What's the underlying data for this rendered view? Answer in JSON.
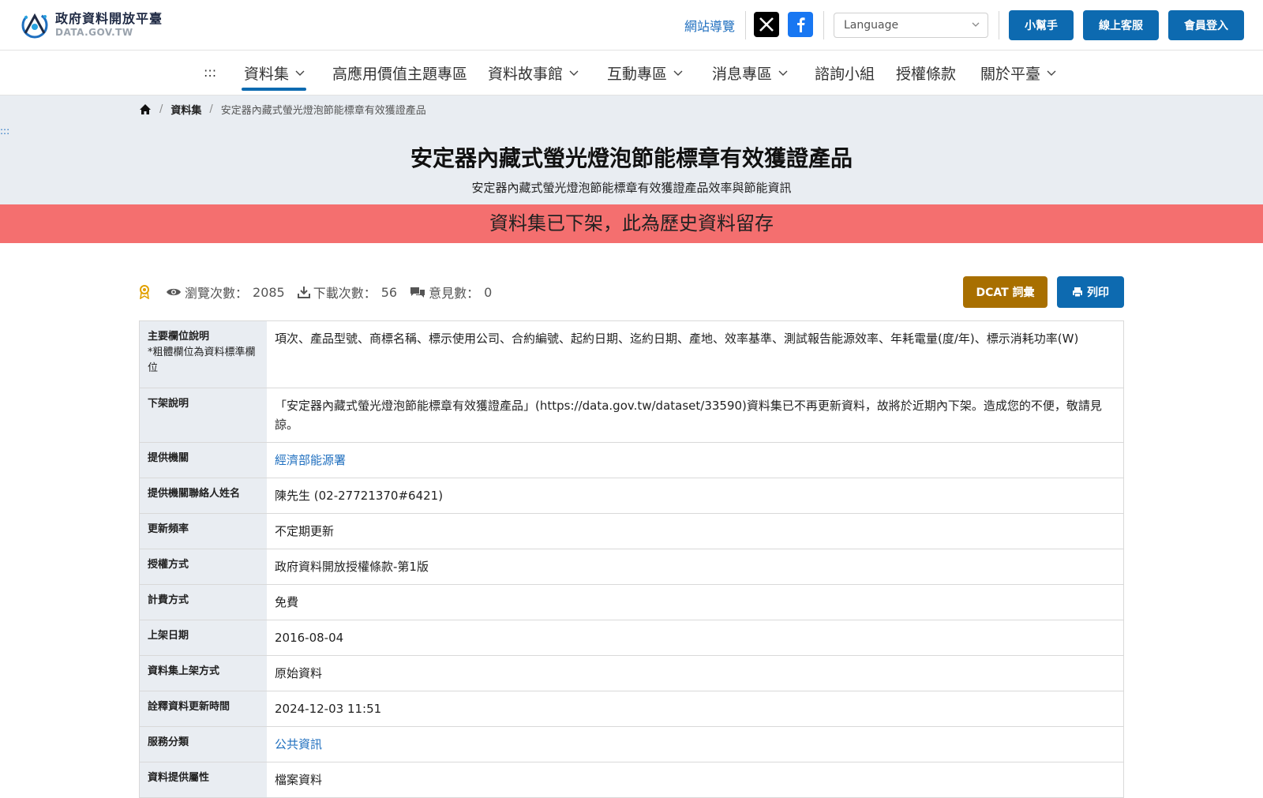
{
  "header": {
    "logo_title": "政府資料開放平臺",
    "logo_sub": "DATA.GOV.TW",
    "sitemap": "網站導覽",
    "language_placeholder": "Language",
    "buttons": {
      "help": "小幫手",
      "support": "線上客服",
      "login": "會員登入"
    }
  },
  "nav": {
    "accesskey": ":::",
    "items": [
      {
        "label": "資料集",
        "dropdown": true
      },
      {
        "label": "高應用價值主題專區",
        "dropdown": false
      },
      {
        "label": "資料故事館",
        "dropdown": true
      },
      {
        "label": "互動專區",
        "dropdown": true
      },
      {
        "label": "消息專區",
        "dropdown": true
      },
      {
        "label": "諮詢小組",
        "dropdown": false
      },
      {
        "label": "授權條款",
        "dropdown": false
      },
      {
        "label": "關於平臺",
        "dropdown": true
      }
    ]
  },
  "breadcrumb": {
    "level1": "資料集",
    "current": "安定器內藏式螢光燈泡節能標章有效獲證產品"
  },
  "band_accesskey": ":::",
  "page": {
    "title": "安定器內藏式螢光燈泡節能標章有效獲證產品",
    "subtitle": "安定器內藏式螢光燈泡節能標章有效獲證產品效率與節能資訊",
    "alert": "資料集已下架，此為歷史資料留存"
  },
  "stats": {
    "views_label": "瀏覽次數：",
    "views": "2085",
    "downloads_label": "下載次數：",
    "downloads": "56",
    "comments_label": "意見數：",
    "comments": "0"
  },
  "actions": {
    "dcat": "DCAT 詞彙",
    "print": "列印"
  },
  "meta": {
    "fields_label": "主要欄位說明",
    "fields_note": "*粗體欄位為資料標準欄位",
    "fields": "項次、產品型號、商標名稱、標示使用公司、合約編號、起約日期、迄約日期、產地、效率基準、測試報告能源效率、年耗電量(度/年)、標示消耗功率(W)",
    "delist_label": "下架說明",
    "delist": "「安定器內藏式螢光燈泡節能標章有效獲證產品」(https://data.gov.tw/dataset/33590)資料集已不再更新資料，故將於近期內下架。造成您的不便，敬請見諒。",
    "agency_label": "提供機關",
    "agency": "經濟部能源署",
    "contact_label": "提供機關聯絡人姓名",
    "contact": "陳先生 (02-27721370#6421)",
    "freq_label": "更新頻率",
    "freq": "不定期更新",
    "license_label": "授權方式",
    "license": "政府資料開放授權條款-第1版",
    "fee_label": "計費方式",
    "fee": "免費",
    "published_label": "上架日期",
    "published": "2016-08-04",
    "method_label": "資料集上架方式",
    "method": "原始資料",
    "updated_label": "詮釋資料更新時間",
    "updated": "2024-12-03 11:51",
    "category_label": "服務分類",
    "category": "公共資訊",
    "type_label": "資料提供屬性",
    "type": "檔案資料"
  }
}
